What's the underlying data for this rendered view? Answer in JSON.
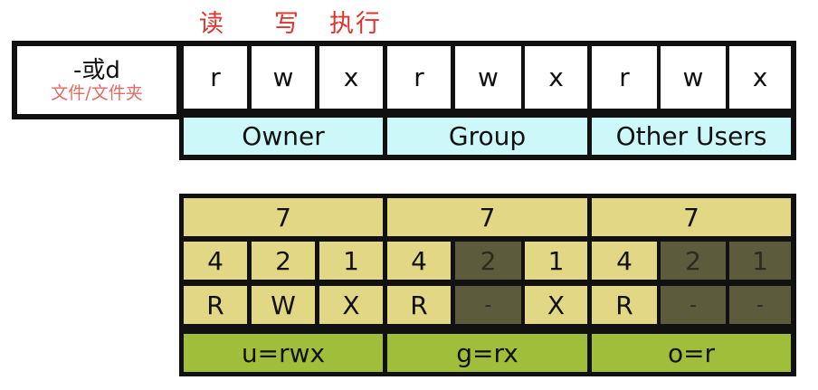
{
  "headers": {
    "read": "读",
    "write": "写",
    "execute": "执行"
  },
  "type_cell": {
    "label": "-或d",
    "caption": "文件/文件夹"
  },
  "permission_letters": [
    "r",
    "w",
    "x",
    "r",
    "w",
    "x",
    "r",
    "w",
    "x"
  ],
  "groups": [
    "Owner",
    "Group",
    "Other Users"
  ],
  "octal_values": [
    "7",
    "7",
    "7"
  ],
  "bit_values": [
    "4",
    "2",
    "1",
    "4",
    "2",
    "1",
    "4",
    "2",
    "1"
  ],
  "bit_active": [
    true,
    true,
    true,
    true,
    false,
    true,
    true,
    false,
    false
  ],
  "flags": [
    "R",
    "W",
    "X",
    "R",
    "-",
    "X",
    "R",
    "-",
    "-"
  ],
  "symbolic": [
    "u=rwx",
    "g=rx",
    "o=r"
  ],
  "colors": {
    "header_text": "#e0332c",
    "group_row": "#cdf8fa",
    "bit_on": "#e2d784",
    "bit_off": "#5c5b3c",
    "symbolic_row": "#a1be3b",
    "border": "#111111"
  }
}
